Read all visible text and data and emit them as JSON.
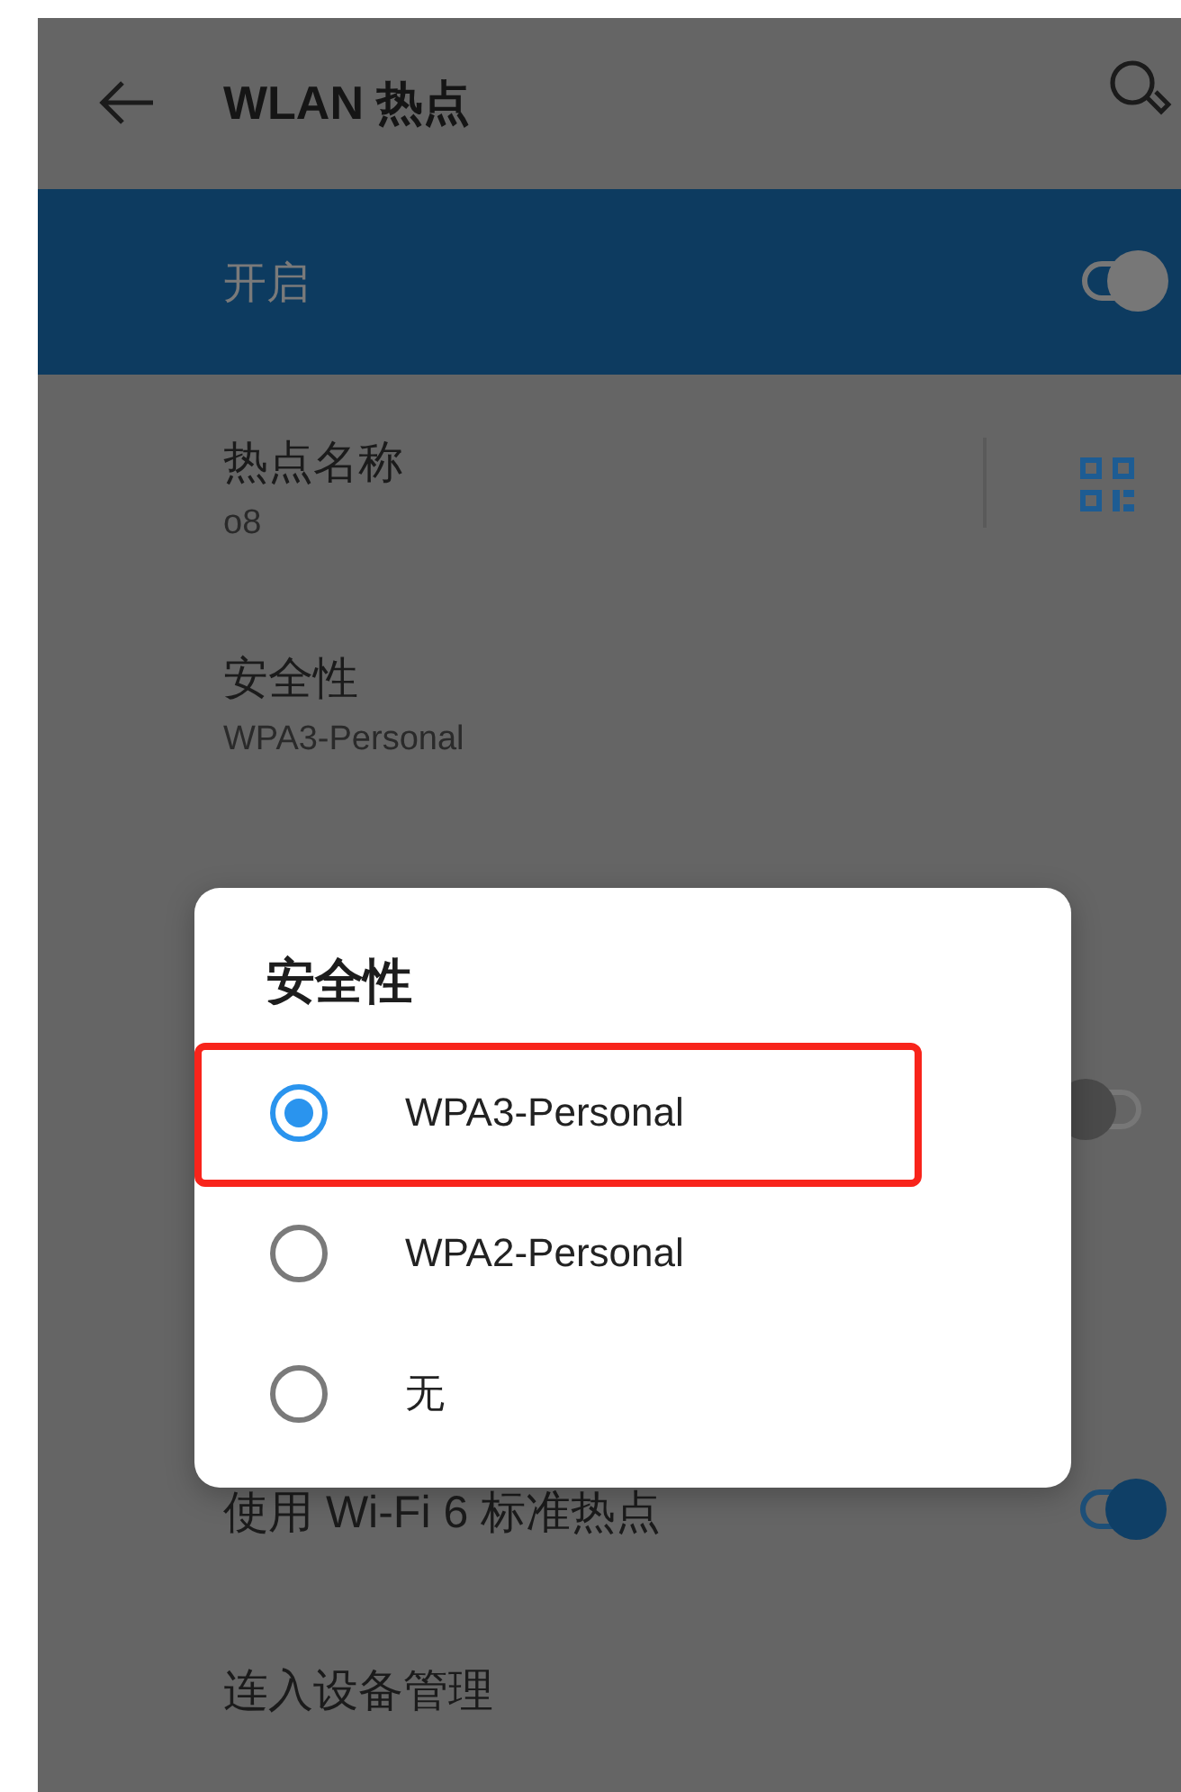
{
  "header": {
    "title": "WLAN 热点"
  },
  "master_switch": {
    "label": "开启",
    "on": true
  },
  "settings": [
    {
      "kind": "name",
      "title": "热点名称",
      "value": "o8"
    },
    {
      "kind": "plain",
      "title": "安全性",
      "value": "WPA3-Personal"
    },
    {
      "kind": "blank"
    },
    {
      "kind": "toggle",
      "on": false
    },
    {
      "kind": "blank"
    },
    {
      "kind": "toggle",
      "title": "使用 Wi-Fi 6 标准热点",
      "on": true
    },
    {
      "kind": "plain",
      "title": "连入设备管理"
    }
  ],
  "dialog": {
    "title": "安全性",
    "options": [
      {
        "label": "WPA3-Personal",
        "selected": true,
        "highlight": true
      },
      {
        "label": "WPA2-Personal",
        "selected": false,
        "highlight": false
      },
      {
        "label": "无",
        "selected": false,
        "highlight": false
      }
    ]
  }
}
